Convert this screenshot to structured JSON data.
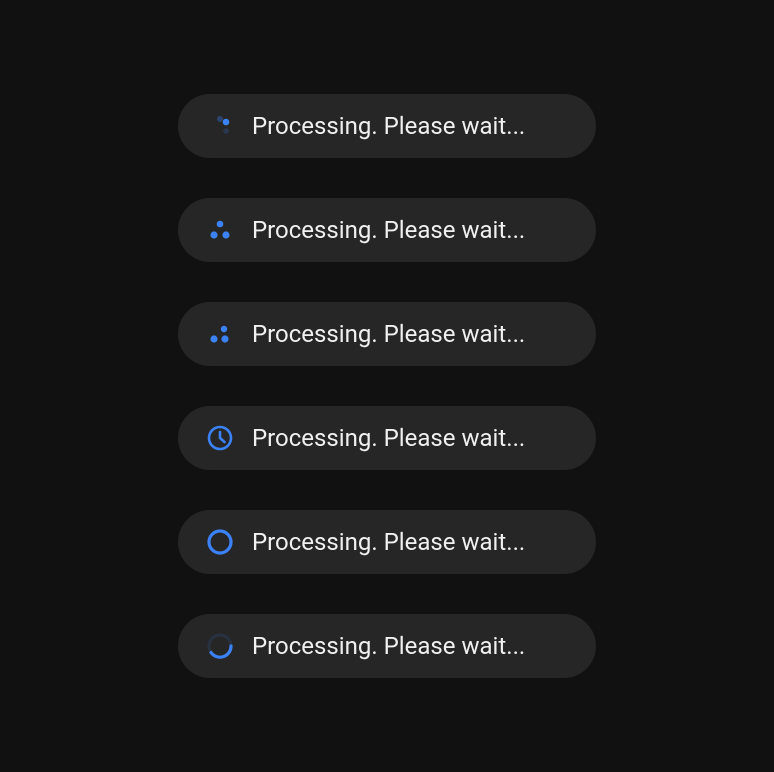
{
  "accent_color": "#3b82f6",
  "items": [
    {
      "icon": "spinner-dots-fade-icon",
      "label": "Processing. Please wait..."
    },
    {
      "icon": "spinner-dots-triangle-icon",
      "label": "Processing. Please wait..."
    },
    {
      "icon": "spinner-dots-variant-icon",
      "label": "Processing. Please wait..."
    },
    {
      "icon": "clock-icon",
      "label": "Processing. Please wait..."
    },
    {
      "icon": "spinner-ring-icon",
      "label": "Processing. Please wait..."
    },
    {
      "icon": "spinner-arc-icon",
      "label": "Processing. Please wait..."
    }
  ]
}
